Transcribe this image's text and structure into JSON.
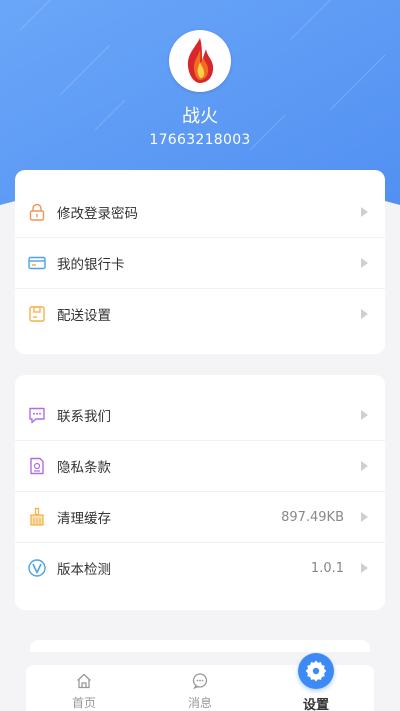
{
  "profile": {
    "name": "战火",
    "phone": "17663218003"
  },
  "account_menu": [
    {
      "label": "修改登录密码",
      "icon": "lock-icon"
    },
    {
      "label": "我的银行卡",
      "icon": "bank-card-icon"
    },
    {
      "label": "配送设置",
      "icon": "delivery-icon"
    }
  ],
  "service_menu": [
    {
      "label": "联系我们",
      "icon": "chat-icon",
      "value": ""
    },
    {
      "label": "隐私条款",
      "icon": "privacy-doc-icon",
      "value": ""
    },
    {
      "label": "清理缓存",
      "icon": "broom-icon",
      "value": "897.49KB"
    },
    {
      "label": "版本检测",
      "icon": "version-icon",
      "value": "1.0.1"
    }
  ],
  "tabs": [
    {
      "label": "首页",
      "icon": "home-icon",
      "active": false
    },
    {
      "label": "消息",
      "icon": "message-icon",
      "active": false
    },
    {
      "label": "设置",
      "icon": "settings-icon",
      "active": true
    }
  ],
  "colors": {
    "header_blue": "#5b9bf6",
    "accent": "#3d8af7",
    "lock_icon": "#f0935a",
    "card_icon": "#4ba3e3",
    "delivery_icon": "#f2b44a",
    "chat_icon": "#b06ee0",
    "privacy_icon": "#b06ee0",
    "broom_icon": "#f2b44a",
    "version_icon": "#4ba3e3"
  }
}
